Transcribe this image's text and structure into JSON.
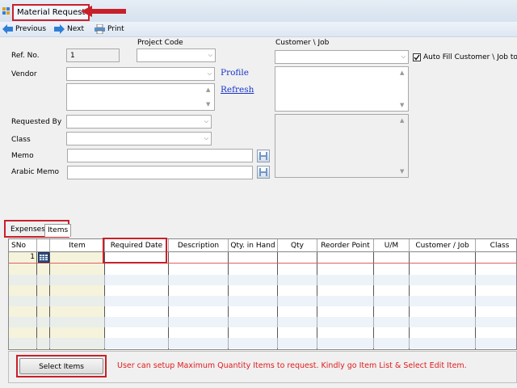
{
  "window": {
    "title": "Material Request"
  },
  "toolbar": {
    "previous": "Previous",
    "next": "Next",
    "print": "Print"
  },
  "form": {
    "ref_label": "Ref. No.",
    "ref_value": "1",
    "project_label": "Project Code",
    "customer_label": "Customer \\ Job",
    "autofill_label": "Auto Fill Customer \\ Job to Cus",
    "vendor_label": "Vendor",
    "profile_link": "Profile",
    "refresh_link": "Refresh",
    "requested_by_label": "Requested By",
    "class_label": "Class",
    "memo_label": "Memo",
    "arabic_memo_label": "Arabic Memo"
  },
  "tabs": [
    "Expenses",
    "Items"
  ],
  "grid": {
    "columns": [
      "SNo",
      "",
      "Item",
      "Required Date",
      "Description",
      "Qty. in Hand",
      "Qty",
      "Reorder Point",
      "U/M",
      "Customer / Job",
      "Class"
    ],
    "rows": [
      {
        "sno": "1"
      }
    ]
  },
  "footer": {
    "select_items": "Select Items",
    "note": "User can setup Maximum Quantity  Items to request. Kindly go Item List & Select Edit Item."
  },
  "colors": {
    "highlight": "#c8202a",
    "link": "#1a35c8",
    "note": "#e11c1c",
    "item_column": "#f6f3dc"
  }
}
